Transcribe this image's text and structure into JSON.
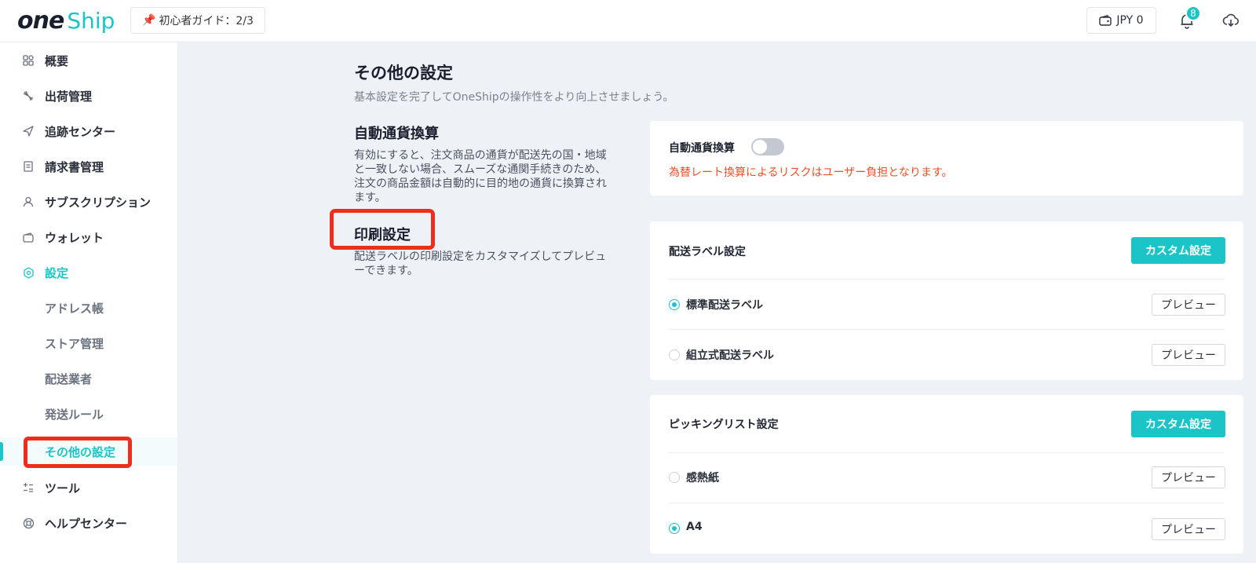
{
  "header": {
    "logo_one": "one",
    "logo_ship": "Ship",
    "guide_label": "初心者ガイド：2/3",
    "wallet_label": "JPY 0",
    "notification_count": "8"
  },
  "sidebar": {
    "items": [
      {
        "label": "概要",
        "icon": "grid-icon"
      },
      {
        "label": "出荷管理",
        "icon": "plane-icon"
      },
      {
        "label": "追跡センター",
        "icon": "send-icon"
      },
      {
        "label": "請求書管理",
        "icon": "invoice-icon"
      },
      {
        "label": "サブスクリプション",
        "icon": "user-icon"
      },
      {
        "label": "ウォレット",
        "icon": "wallet-icon"
      },
      {
        "label": "設定",
        "icon": "gear-icon"
      }
    ],
    "sub_items": [
      {
        "label": "アドレス帳"
      },
      {
        "label": "ストア管理"
      },
      {
        "label": "配送業者"
      },
      {
        "label": "発送ルール"
      },
      {
        "label": "その他の設定"
      }
    ],
    "bottom_items": [
      {
        "label": "ツール",
        "icon": "tools-icon"
      },
      {
        "label": "ヘルプセンター",
        "icon": "lifebuoy-icon"
      }
    ]
  },
  "main": {
    "title": "その他の設定",
    "subtitle": "基本設定を完了してOneShipの操作性をより向上させましょう。",
    "currency_section": {
      "title": "自動通貨換算",
      "desc_lines": [
        "有効にすると、注文商品の通貨が配送先の国・地域",
        "と一致しない場合、スムーズな通関手続きのため、",
        "注文の商品金額は自動的に目的地の通貨に換算され",
        "ます。"
      ],
      "toggle_label": "自動通貨換算",
      "toggle_on": false,
      "warning": "為替レート換算によるリスクはユーザー負担となります。"
    },
    "print_section": {
      "title": "印刷設定",
      "desc_lines": [
        "配送ラベルの印刷設定をカスタマイズしてプレビュ",
        "ーできます。"
      ]
    },
    "label_card": {
      "title": "配送ラベル設定",
      "custom_button": "カスタム設定",
      "options": [
        {
          "label": "標準配送ラベル",
          "selected": true,
          "preview": "プレビュー"
        },
        {
          "label": "組立式配送ラベル",
          "selected": false,
          "preview": "プレビュー"
        }
      ]
    },
    "picking_card": {
      "title": "ピッキングリスト設定",
      "custom_button": "カスタム設定",
      "options": [
        {
          "label": "感熱紙",
          "selected": false,
          "preview": "プレビュー"
        },
        {
          "label": "A4",
          "selected": true,
          "preview": "プレビュー"
        }
      ]
    }
  },
  "colors": {
    "accent": "#1bc4c6",
    "warning": "#f04e23",
    "highlight": "#ee2d1d",
    "background": "#eef1f6"
  }
}
